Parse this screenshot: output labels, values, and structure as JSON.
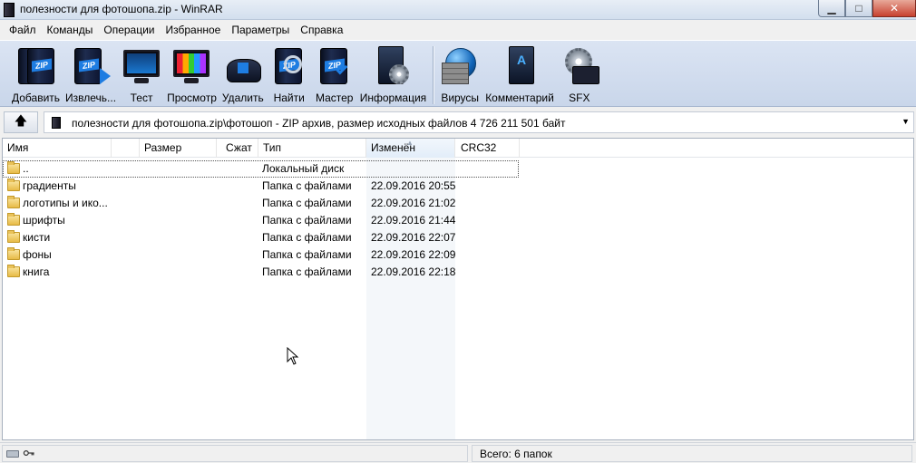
{
  "window": {
    "title": "полезности для фотошопа.zip - WinRAR",
    "controls": {
      "minimize": "▁",
      "maximize": "□",
      "close": "✕"
    }
  },
  "menu": [
    "Файл",
    "Команды",
    "Операции",
    "Избранное",
    "Параметры",
    "Справка"
  ],
  "toolbar": [
    {
      "label": "Добавить",
      "icon": "add-archive-icon"
    },
    {
      "label": "Извлечь...",
      "icon": "extract-icon"
    },
    {
      "label": "Тест",
      "icon": "test-icon"
    },
    {
      "label": "Просмотр",
      "icon": "view-icon"
    },
    {
      "label": "Удалить",
      "icon": "delete-icon"
    },
    {
      "label": "Найти",
      "icon": "find-icon"
    },
    {
      "label": "Мастер",
      "icon": "wizard-icon"
    },
    {
      "label": "Информация",
      "icon": "info-icon"
    },
    {
      "label": "Вирусы",
      "icon": "virus-scan-icon"
    },
    {
      "label": "Комментарий",
      "icon": "comment-icon"
    },
    {
      "label": "SFX",
      "icon": "sfx-icon"
    }
  ],
  "address": {
    "up_label": "🡅",
    "path": "полезности для фотошопа.zip\\фотошоп - ZIP архив, размер исходных файлов 4 726 211 501 байт",
    "dropdown": "▼"
  },
  "columns": {
    "name": "Имя",
    "size": "Размер",
    "packed": "Сжат",
    "type": "Тип",
    "modified": "Изменён",
    "crc": "CRC32"
  },
  "files": [
    {
      "name": "..",
      "type": "Локальный диск",
      "modified": ""
    },
    {
      "name": "градиенты",
      "type": "Папка с файлами",
      "modified": "22.09.2016 20:55"
    },
    {
      "name": "логотипы и ико...",
      "type": "Папка с файлами",
      "modified": "22.09.2016 21:02"
    },
    {
      "name": "шрифты",
      "type": "Папка с файлами",
      "modified": "22.09.2016 21:44"
    },
    {
      "name": "кисти",
      "type": "Папка с файлами",
      "modified": "22.09.2016 22:07"
    },
    {
      "name": "фоны",
      "type": "Папка с файлами",
      "modified": "22.09.2016 22:09"
    },
    {
      "name": "книга",
      "type": "Папка с файлами",
      "modified": "22.09.2016 22:18"
    }
  ],
  "status": {
    "total": "Всего: 6 папок"
  }
}
